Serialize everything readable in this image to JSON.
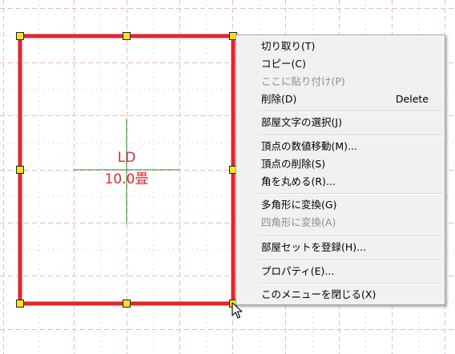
{
  "room": {
    "name": "LD",
    "area": "10.0畳",
    "outline_color": "#e0262f"
  },
  "context_menu": {
    "items": [
      {
        "label": "切り取り(T)",
        "shortcut": "",
        "disabled": false
      },
      {
        "label": "コピー(C)",
        "shortcut": "",
        "disabled": false
      },
      {
        "label": "ここに貼り付け(P)",
        "shortcut": "",
        "disabled": true
      },
      {
        "label": "削除(D)",
        "shortcut": "Delete",
        "disabled": false
      },
      {
        "label": "部屋文字の選択(J)",
        "shortcut": "",
        "disabled": false
      },
      {
        "label": "頂点の数値移動(M)...",
        "shortcut": "",
        "disabled": false
      },
      {
        "label": "頂点の削除(S)",
        "shortcut": "",
        "disabled": false
      },
      {
        "label": "角を丸める(R)...",
        "shortcut": "",
        "disabled": false
      },
      {
        "label": "多角形に変換(G)",
        "shortcut": "",
        "disabled": false
      },
      {
        "label": "四角形に変換(A)",
        "shortcut": "",
        "disabled": true
      },
      {
        "label": "部屋セットを登録(H)...",
        "shortcut": "",
        "disabled": false
      },
      {
        "label": "プロパティ(E)...",
        "shortcut": "",
        "disabled": false
      },
      {
        "label": "このメニューを閉じる(X)",
        "shortcut": "",
        "disabled": false
      }
    ]
  },
  "colors": {
    "grid_dashed": "#e6b9c4",
    "grid_dotted": "#c9ccd6",
    "crosshair": "#2f8a2f",
    "handle_fill": "#f3e41c",
    "label_red": "#d92c33"
  }
}
